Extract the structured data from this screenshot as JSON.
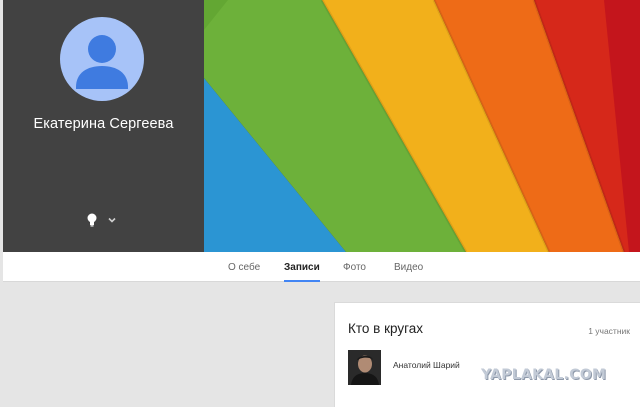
{
  "profile": {
    "name": "Екатерина Сергеева",
    "avatar_icon": "default-person-icon",
    "status_icon": "lightbulb-icon",
    "menu_icon": "chevron-down-icon"
  },
  "cover": {
    "stripe_colors": [
      "#2b95d3",
      "#6db13a",
      "#f2b01b",
      "#ee6b17",
      "#d6281a",
      "#c4151c"
    ]
  },
  "tabs": [
    {
      "label": "О себе",
      "active": false
    },
    {
      "label": "Записи",
      "active": true
    },
    {
      "label": "Фото",
      "active": false
    },
    {
      "label": "Видео",
      "active": false
    }
  ],
  "circles": {
    "title": "Кто в кругах",
    "count": "1 участник",
    "members": [
      {
        "name": "Анатолий Шарий"
      }
    ]
  },
  "watermark": "YAPLAKAL.COM",
  "colors": {
    "accent": "#4285f4",
    "panel": "#424242",
    "avatar_bg": "#a7c3f8",
    "avatar_fg": "#3f7be0"
  }
}
